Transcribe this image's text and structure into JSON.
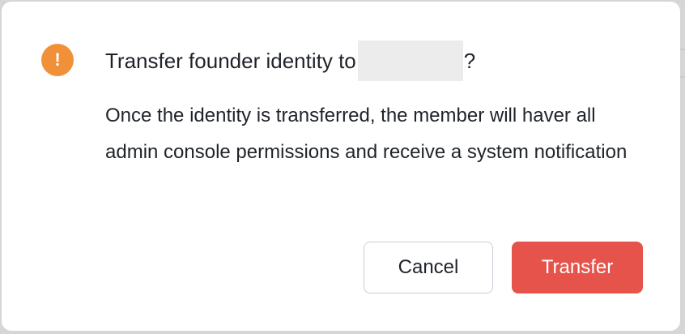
{
  "dialog": {
    "title_prefix": "Transfer founder identity to",
    "title_suffix": "?",
    "message": "Once the identity is transferred, the member will haver all admin console permissions and receive a system notification",
    "cancel_label": "Cancel",
    "transfer_label": "Transfer",
    "warning_glyph": "!",
    "icon": "exclamation-circle-icon"
  },
  "colors": {
    "warning": "#f0913a",
    "danger": "#e5534b",
    "text": "#1f2329"
  }
}
